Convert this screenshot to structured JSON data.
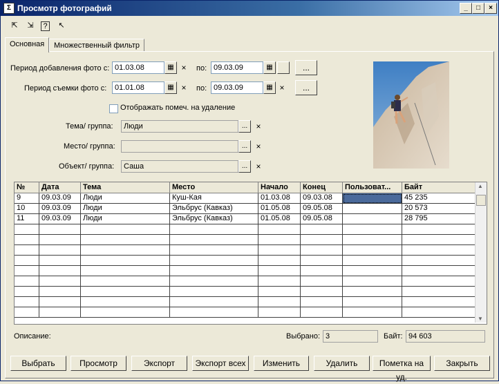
{
  "window": {
    "title": "Просмотр фотографий"
  },
  "tabs": [
    {
      "label": "Основная"
    },
    {
      "label": "Множественный фильтр"
    }
  ],
  "filters": {
    "added_label": "Период добавления фото с:",
    "added_from": "01.03.08",
    "added_to": "09.03.09",
    "shot_label": "Период съемки фото с:",
    "shot_from": "01.01.08",
    "shot_to": "09.03.09",
    "to_label": "по:",
    "ellipsis": "...",
    "show_deleted_label": "Отображать помеч. на удаление",
    "theme_label": "Тема/ группа:",
    "theme_value": "Люди",
    "place_label": "Место/ группа:",
    "place_value": "",
    "object_label": "Объект/ группа:",
    "object_value": "Саша"
  },
  "table": {
    "columns": [
      "№",
      "Дата",
      "Тема",
      "Место",
      "Начало",
      "Конец",
      "Пользоват...",
      "Байт"
    ],
    "rows": [
      [
        "9",
        "09.03.09",
        "Люди",
        "Куш-Кая",
        "01.03.08",
        "09.03.08",
        "",
        "45 235"
      ],
      [
        "10",
        "09.03.09",
        "Люди",
        "Эльбрус (Кавказ)",
        "01.05.08",
        "09.05.08",
        "",
        "20 573"
      ],
      [
        "11",
        "09.03.09",
        "Люди",
        "Эльбрус (Кавказ)",
        "01.05.08",
        "09.05.08",
        "",
        "28 795"
      ]
    ]
  },
  "footer": {
    "description_label": "Описание:",
    "selected_label": "Выбрано:",
    "selected_value": "3",
    "bytes_label": "Байт:",
    "bytes_value": "94 603"
  },
  "buttons": {
    "select": "Выбрать",
    "view": "Просмотр",
    "export": "Экспорт",
    "export_all": "Экспорт всех",
    "edit": "Изменить",
    "delete": "Удалить",
    "mark": "Пометка на уд.",
    "close": "Закрыть"
  }
}
